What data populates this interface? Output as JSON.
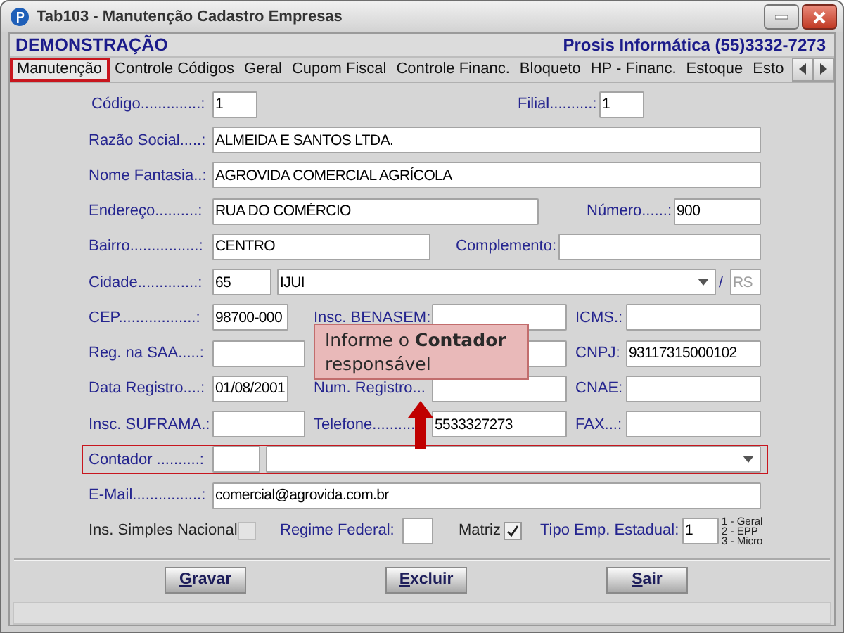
{
  "window": {
    "title": "Tab103 - Manutenção Cadastro Empresas"
  },
  "header": {
    "company": "DEMONSTRAÇÃO",
    "contact": "Prosis Informática (55)3332-7273"
  },
  "tabs": [
    {
      "label": "Manutenção",
      "selected": true,
      "highlighted": true
    },
    {
      "label": "Controle Códigos",
      "selected": false,
      "highlighted": false
    },
    {
      "label": "Geral",
      "selected": false,
      "highlighted": false
    },
    {
      "label": "Cupom Fiscal",
      "selected": false,
      "highlighted": false
    },
    {
      "label": "Controle Financ.",
      "selected": false,
      "highlighted": false
    },
    {
      "label": "Bloqueto",
      "selected": false,
      "highlighted": false
    },
    {
      "label": "HP - Financ.",
      "selected": false,
      "highlighted": false
    },
    {
      "label": "Estoque",
      "selected": false,
      "highlighted": false
    },
    {
      "label": "Esto",
      "selected": false,
      "highlighted": false
    }
  ],
  "form": {
    "rows": [
      {
        "highlighted": false,
        "items": [
          {
            "kind": "label",
            "text": "Código..............:"
          },
          {
            "kind": "field",
            "value": "1"
          },
          {
            "kind": "label",
            "text": "Filial..........:"
          },
          {
            "kind": "field",
            "value": "1"
          }
        ]
      },
      {
        "highlighted": false,
        "items": [
          {
            "kind": "label",
            "text": "Razão Social.....:"
          },
          {
            "kind": "field",
            "value": "ALMEIDA E SANTOS LTDA."
          }
        ]
      },
      {
        "highlighted": false,
        "items": [
          {
            "kind": "label",
            "text": "Nome Fantasia..:"
          },
          {
            "kind": "field",
            "value": "AGROVIDA COMERCIAL AGRÍCOLA"
          }
        ]
      },
      {
        "highlighted": false,
        "items": [
          {
            "kind": "label",
            "text": "Endereço..........:"
          },
          {
            "kind": "field",
            "value": "RUA DO COMÉRCIO"
          },
          {
            "kind": "label",
            "text": "Número......:"
          },
          {
            "kind": "field",
            "value": "900"
          }
        ]
      },
      {
        "highlighted": false,
        "items": [
          {
            "kind": "label",
            "text": "Bairro................:"
          },
          {
            "kind": "field",
            "value": "CENTRO"
          },
          {
            "kind": "label",
            "text": "Complemento:"
          },
          {
            "kind": "field"
          }
        ]
      },
      {
        "highlighted": false,
        "items": [
          {
            "kind": "label",
            "text": "Cidade..............:"
          },
          {
            "kind": "field",
            "value": "65"
          },
          {
            "kind": "combo",
            "value": "IJUI"
          },
          {
            "kind": "label",
            "text": "/"
          },
          {
            "kind": "field",
            "value": "RS",
            "disabled": true
          }
        ]
      },
      {
        "highlighted": false,
        "items": [
          {
            "kind": "label",
            "text": "CEP..................:"
          },
          {
            "kind": "field",
            "value": "98700-000"
          },
          {
            "kind": "label",
            "text": "Insc. BENASEM:"
          },
          {
            "kind": "field"
          },
          {
            "kind": "label",
            "text": "ICMS.:"
          },
          {
            "kind": "field"
          }
        ]
      },
      {
        "highlighted": false,
        "items": [
          {
            "kind": "label",
            "text": "Reg. na SAA.....:"
          },
          {
            "kind": "field"
          },
          {
            "kind": "field"
          },
          {
            "kind": "label",
            "text": "CNPJ:"
          },
          {
            "kind": "field",
            "value": "93117315000102"
          }
        ]
      },
      {
        "highlighted": false,
        "items": [
          {
            "kind": "label",
            "text": "Data Registro....:"
          },
          {
            "kind": "field",
            "value": "01/08/2001"
          },
          {
            "kind": "label",
            "text": "Num. Registro..."
          },
          {
            "kind": "field"
          },
          {
            "kind": "label",
            "text": "CNAE:"
          },
          {
            "kind": "field"
          }
        ]
      },
      {
        "highlighted": false,
        "items": [
          {
            "kind": "label",
            "text": "Insc. SUFRAMA.:"
          },
          {
            "kind": "field"
          },
          {
            "kind": "label",
            "text": "Telefone.........."
          },
          {
            "kind": "field",
            "value": "5533327273"
          },
          {
            "kind": "label",
            "text": "FAX...:"
          },
          {
            "kind": "field"
          }
        ]
      },
      {
        "highlighted": true,
        "items": [
          {
            "kind": "label",
            "text": "Contador ..........:"
          },
          {
            "kind": "field"
          },
          {
            "kind": "combo"
          }
        ]
      },
      {
        "highlighted": false,
        "items": [
          {
            "kind": "label",
            "text": "E-Mail................:"
          },
          {
            "kind": "field",
            "value": "comercial@agrovida.com.br"
          }
        ]
      },
      {
        "highlighted": false,
        "items": [
          {
            "kind": "caption",
            "text": "Ins. Simples Nacional"
          },
          {
            "kind": "checkbox",
            "checked": false
          },
          {
            "kind": "label",
            "text": "Regime Federal:"
          },
          {
            "kind": "field"
          },
          {
            "kind": "caption",
            "text": "Matriz"
          },
          {
            "kind": "checkbox",
            "checked": true
          },
          {
            "kind": "label",
            "text": "Tipo Emp. Estadual:"
          },
          {
            "kind": "field",
            "value": "1"
          },
          {
            "kind": "legend",
            "lines": [
              "1 - Geral",
              "2 - EPP",
              "3 - Micro"
            ]
          }
        ]
      }
    ]
  },
  "tooltip": {
    "text": "Informe o **Contador** responsável"
  },
  "buttons": [
    {
      "label": "Gravar"
    },
    {
      "label": "Excluir"
    },
    {
      "label": "Sair"
    }
  ]
}
